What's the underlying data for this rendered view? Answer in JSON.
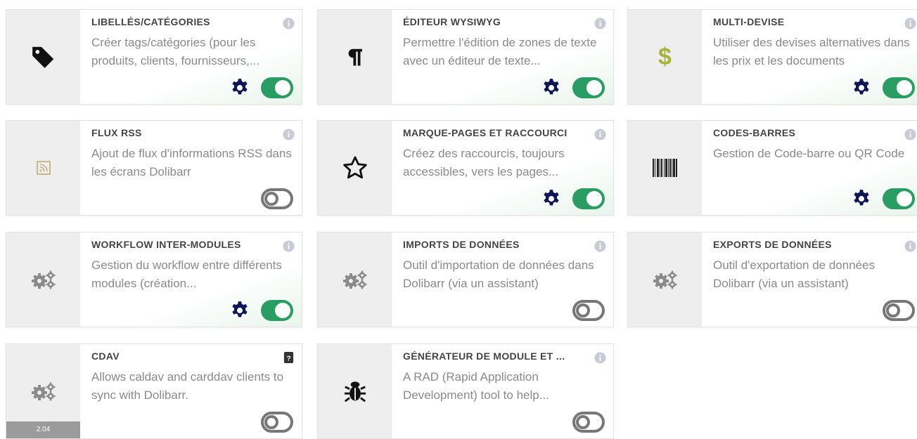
{
  "modules": [
    {
      "title": "LIBELLÉS/CATÉGORIES",
      "desc": "Créer tags/catégories (pour les produits, clients, fournisseurs,...",
      "icon": "tag-icon",
      "enabled": true,
      "has_config": true,
      "info_icon": "info-icon"
    },
    {
      "title": "ÉDITEUR WYSIWYG",
      "desc": "Permettre l'édition de zones de texte avec un éditeur de texte...",
      "icon": "paragraph-icon",
      "enabled": true,
      "has_config": true,
      "info_icon": "info-icon"
    },
    {
      "title": "MULTI-DEVISE",
      "desc": "Utiliser des devises alternatives dans les prix et les documents",
      "icon": "dollar-icon",
      "enabled": true,
      "has_config": true,
      "info_icon": "info-icon"
    },
    {
      "title": "FLUX RSS",
      "desc": "Ajout de flux d'informations RSS dans les écrans Dolibarr",
      "icon": "rss-icon",
      "enabled": false,
      "has_config": false,
      "info_icon": "info-icon"
    },
    {
      "title": "MARQUE-PAGES ET RACCOURCI",
      "desc": "Créez des raccourcis, toujours accessibles, vers les pages...",
      "icon": "star-icon",
      "enabled": true,
      "has_config": true,
      "info_icon": "info-icon"
    },
    {
      "title": "CODES-BARRES",
      "desc": "Gestion de Code-barre ou QR Code",
      "icon": "barcode-icon",
      "enabled": true,
      "has_config": true,
      "info_icon": "info-icon"
    },
    {
      "title": "WORKFLOW INTER-MODULES",
      "desc": "Gestion du workflow entre différents modules (création...",
      "icon": "cogs-icon",
      "enabled": true,
      "has_config": true,
      "info_icon": "info-icon"
    },
    {
      "title": "IMPORTS DE DONNÉES",
      "desc": "Outil d'importation de données dans Dolibarr (via un assistant)",
      "icon": "cogs-icon",
      "enabled": false,
      "has_config": false,
      "info_icon": "info-icon"
    },
    {
      "title": "EXPORTS DE DONNÉES",
      "desc": "Outil d'exportation de données Dolibarr (via un assistant)",
      "icon": "cogs-icon",
      "enabled": false,
      "has_config": false,
      "info_icon": "info-icon"
    },
    {
      "title": "CDAV",
      "desc": "Allows caldav and carddav clients to sync with Dolibarr.",
      "icon": "cogs-icon",
      "enabled": false,
      "has_config": false,
      "info_icon": "question-icon",
      "version": "2.04"
    },
    {
      "title": "GÉNÉRATEUR DE MODULE ET ...",
      "desc": "A RAD (Rapid Application Development) tool to help...",
      "icon": "bug-icon",
      "enabled": false,
      "has_config": false,
      "info_icon": "info-icon"
    }
  ],
  "colors": {
    "toggle_on": "#2a9d62",
    "toggle_off": "#777777",
    "gear": "#0f1657",
    "icon_tile": "#eeeeee",
    "dollar": "#a7b43c",
    "rss": "#c8b98c"
  }
}
